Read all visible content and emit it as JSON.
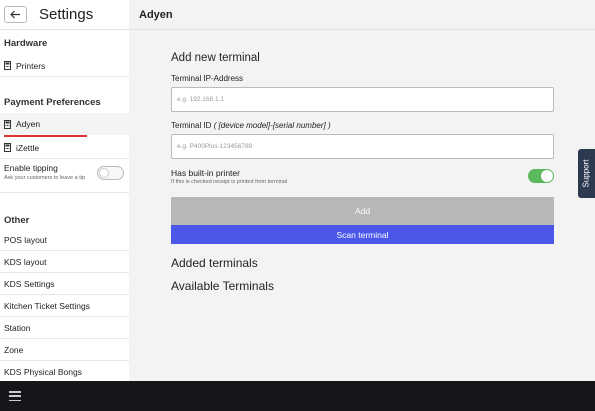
{
  "sidebar": {
    "title": "Settings",
    "hardware": {
      "title": "Hardware",
      "items": [
        {
          "label": "Printers",
          "icon": "pos-terminal-icon"
        }
      ]
    },
    "payment": {
      "title": "Payment Preferences",
      "items": [
        {
          "label": "Adyen",
          "icon": "pos-terminal-icon",
          "active": true
        },
        {
          "label": "iZettle",
          "icon": "pos-terminal-icon"
        }
      ],
      "tipping": {
        "label": "Enable tipping",
        "sublabel": "Ask your customers to leave a tip",
        "enabled": false
      }
    },
    "other": {
      "title": "Other",
      "items": [
        "POS layout",
        "KDS layout",
        "KDS Settings",
        "Kitchen Ticket Settings",
        "Station",
        "Zone",
        "KDS Physical Bongs"
      ]
    }
  },
  "main": {
    "title": "Adyen",
    "add_heading": "Add new terminal",
    "ip_label": "Terminal IP-Address",
    "ip_placeholder": "e.g. 192.168.1.1",
    "id_label_prefix": "Terminal ID",
    "id_label_hint": "( [device model]-[serial number] )",
    "id_placeholder": "e.g. P400Plus-123456789",
    "builtin_label": "Has built-in printer",
    "builtin_sub": "If this is checked receipt is printed from terminal",
    "builtin_enabled": true,
    "add_button": "Add",
    "scan_button": "Scan terminal",
    "added_heading": "Added terminals",
    "available_heading": "Available Terminals"
  },
  "support_tab": "Support",
  "colors": {
    "accent_red": "#dd3333",
    "scan_blue": "#4a57e8",
    "toggle_green": "#5cb85c",
    "bottom_bar": "#15161a",
    "support_tab": "#2b3a4e"
  }
}
